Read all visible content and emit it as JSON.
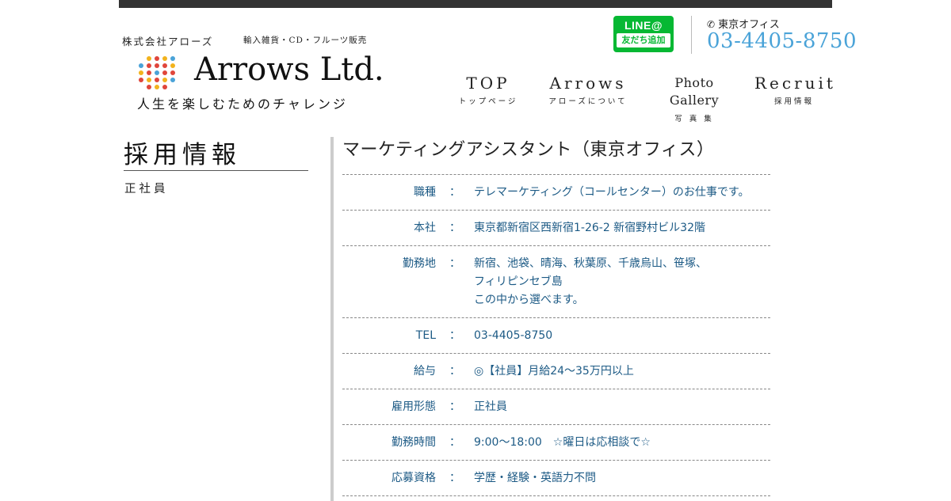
{
  "header": {
    "company_name": "株式会社アローズ",
    "business": "輸入雑貨・CD・フルーツ販売",
    "logo_text": "Arrows Ltd.",
    "slogan": "人生を楽しむためのチャレンジ",
    "line_badge": {
      "top": "LINE@",
      "bottom": "友だち追加"
    },
    "office_label": "東京オフィス",
    "office_tel": "03-4405-8750",
    "colors": {
      "line_green": "#06b833",
      "tel_blue": "#4aa3d8"
    }
  },
  "nav": [
    {
      "en": "TOP",
      "ja": "トップページ"
    },
    {
      "en": "Arrows",
      "ja": "アローズについて"
    },
    {
      "en": "Photo Gallery",
      "ja": "写 真 集"
    },
    {
      "en": "Recruit",
      "ja": "採用情報"
    }
  ],
  "sidebar": {
    "title": "採用情報",
    "items": [
      {
        "label": "正社員"
      }
    ]
  },
  "main": {
    "title": "マーケティングアシスタント（東京オフィス）",
    "separator": "：",
    "rows": [
      {
        "label": "職種",
        "lines": [
          "テレマーケティング（コールセンター）のお仕事です。"
        ]
      },
      {
        "label": "本社",
        "lines": [
          "東京都新宿区西新宿1-26-2 新宿野村ビル32階"
        ]
      },
      {
        "label": "勤務地",
        "lines": [
          "新宿、池袋、晴海、秋葉原、千歳烏山、笹塚、",
          "フィリピンセブ島",
          "この中から選べます。"
        ]
      },
      {
        "label": "TEL",
        "lines": [
          "03-4405-8750"
        ]
      },
      {
        "label": "給与",
        "lines": [
          "◎【社員】月給24〜35万円以上"
        ]
      },
      {
        "label": "雇用形態",
        "lines": [
          "正社員"
        ]
      },
      {
        "label": "勤務時間",
        "lines": [
          "9:00〜18:00　☆曜日は応相談で☆"
        ]
      },
      {
        "label": "応募資格",
        "lines": [
          "学歴・経験・英語力不問"
        ]
      }
    ]
  }
}
